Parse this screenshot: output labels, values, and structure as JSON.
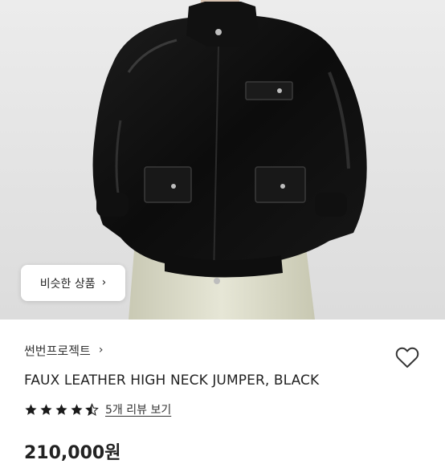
{
  "product": {
    "similar_button_label": "비슷한 상품",
    "brand_name": "썬번프로젝트",
    "title": "FAUX LEATHER HIGH NECK JUMPER, BLACK",
    "rating": 4.5,
    "review_link": "5개 리뷰 보기",
    "price_text": "210,000원"
  },
  "icons": {
    "wishlist": "heart-outline-icon",
    "chevron": "chevron-right-icon",
    "star": "star-icon"
  },
  "colors": {
    "star": "#1a1a1a",
    "jacket": "#111111"
  }
}
